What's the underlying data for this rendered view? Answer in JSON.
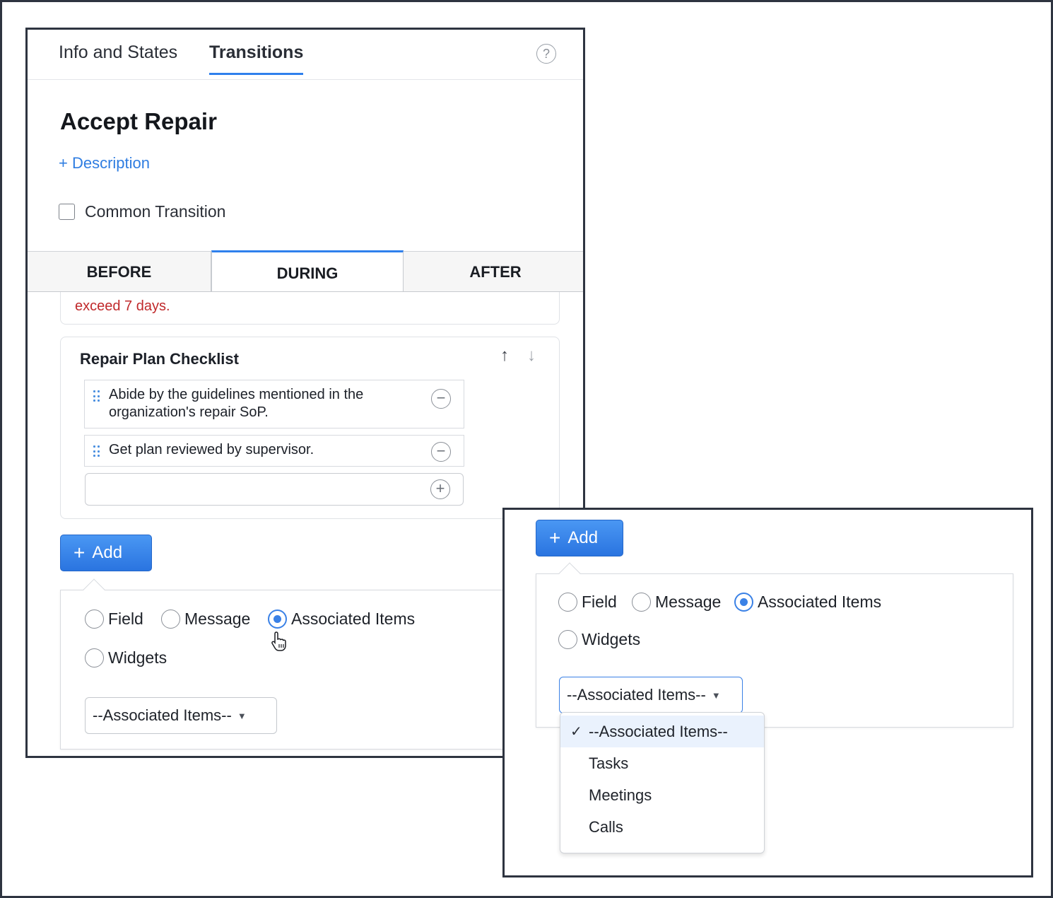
{
  "tabs": {
    "info_states": "Info and States",
    "transitions": "Transitions",
    "help": "?"
  },
  "transition": {
    "title": "Accept Repair",
    "description_link": "+ Description",
    "common_label": "Common Transition"
  },
  "phases": {
    "before": "BEFORE",
    "during": "DURING",
    "after": "AFTER"
  },
  "message": {
    "text": "exceed 7 days."
  },
  "checklist": {
    "title": "Repair Plan Checklist",
    "up_icon": "↑",
    "down_icon": "↓",
    "items": [
      {
        "text": "Abide by the guidelines mentioned in the organization's repair SoP."
      },
      {
        "text": "Get plan reviewed by supervisor."
      }
    ],
    "remove_icon": "−",
    "add_icon": "+"
  },
  "add_button": {
    "plus": "+",
    "label": "Add"
  },
  "type_options": {
    "field": "Field",
    "message": "Message",
    "associated": "Associated Items",
    "widgets": "Widgets",
    "selected": "Associated Items"
  },
  "assoc_select": {
    "value": "--Associated Items--",
    "arrow": "▼"
  },
  "dropdown": {
    "check": "✓",
    "options": [
      "--Associated Items--",
      "Tasks",
      "Meetings",
      "Calls"
    ],
    "selected_index": 0
  },
  "colors": {
    "accent": "#2f80ed",
    "error": "#c0292b",
    "button": "#2a74e0"
  }
}
